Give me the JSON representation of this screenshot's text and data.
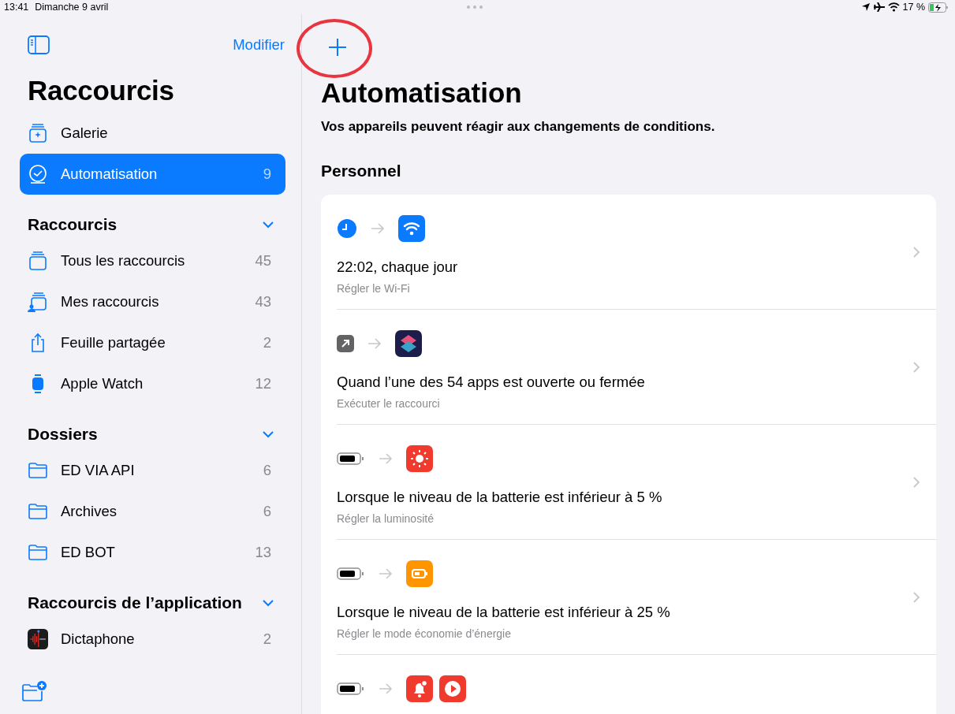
{
  "status_bar": {
    "time": "13:41",
    "date": "Dimanche 9 avril",
    "battery": "17 %"
  },
  "sidebar": {
    "edit_button": "Modifier",
    "title": "Raccourcis",
    "top_items": [
      {
        "kind": "gallery",
        "label": "Galerie",
        "selected": false
      },
      {
        "kind": "clock",
        "label": "Automatisation",
        "count": "9",
        "selected": true
      }
    ],
    "sections": [
      {
        "title": "Raccourcis",
        "expanded": true,
        "items": [
          {
            "kind": "stack",
            "label": "Tous les raccourcis",
            "count": "45",
            "selected": false
          },
          {
            "kind": "stackperson",
            "label": "Mes raccourcis",
            "count": "43",
            "selected": false
          },
          {
            "kind": "share",
            "label": "Feuille partagée",
            "count": "2",
            "selected": false
          },
          {
            "kind": "watch",
            "label": "Apple Watch",
            "count": "12",
            "selected": false
          }
        ]
      },
      {
        "title": "Dossiers",
        "expanded": true,
        "items": [
          {
            "kind": "folder",
            "label": "ED VIA API",
            "count": "6",
            "selected": false
          },
          {
            "kind": "folder",
            "label": "Archives",
            "count": "6",
            "selected": false
          },
          {
            "kind": "folder",
            "label": "ED BOT",
            "count": "13",
            "selected": false
          }
        ]
      },
      {
        "title": "Raccourcis de l’application",
        "expanded": true,
        "items": [
          {
            "kind": "voiceapp",
            "label": "Dictaphone",
            "count": "2",
            "selected": false
          }
        ]
      }
    ]
  },
  "main": {
    "title": "Automatisation",
    "subtitle": "Vos appareils peuvent réagir aux changements de conditions.",
    "section": "Personnel",
    "automations": [
      {
        "trigger": {
          "kind": "clock"
        },
        "actions": [
          {
            "kind": "wifi"
          }
        ],
        "title": "22:02, chaque jour",
        "subtitle": "Régler le Wi-Fi"
      },
      {
        "trigger": {
          "kind": "app"
        },
        "actions": [
          {
            "kind": "shortcuts"
          }
        ],
        "title": "Quand l’une des 54 apps est ouverte ou fermée",
        "subtitle": "Exécuter le raccourci"
      },
      {
        "trigger": {
          "kind": "battery"
        },
        "actions": [
          {
            "kind": "brightness"
          }
        ],
        "title": "Lorsque le niveau de la batterie est inférieur à 5 %",
        "subtitle": "Régler la luminosité"
      },
      {
        "trigger": {
          "kind": "battery"
        },
        "actions": [
          {
            "kind": "lowpower"
          }
        ],
        "title": "Lorsque le niveau de la batterie est inférieur à 25 %",
        "subtitle": "Régler le mode économie d’énergie"
      },
      {
        "trigger": {
          "kind": "battery"
        },
        "actions": [
          {
            "kind": "alert"
          },
          {
            "kind": "play"
          }
        ]
      }
    ]
  }
}
